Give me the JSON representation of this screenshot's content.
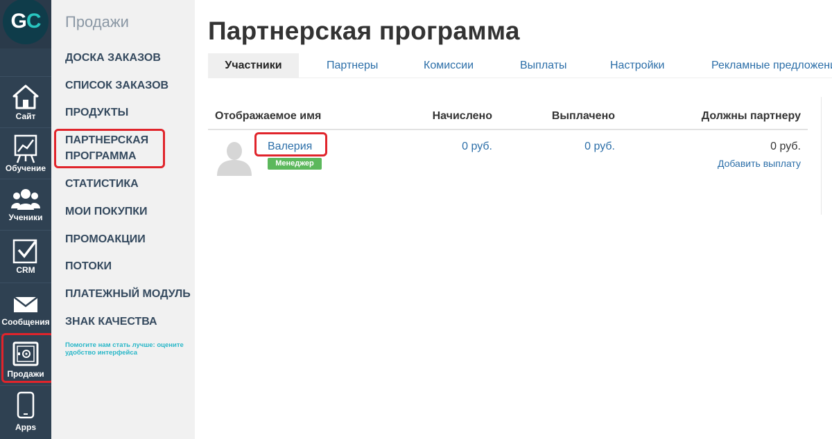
{
  "rail": {
    "logo": {
      "g": "G",
      "c": "C"
    },
    "items": [
      {
        "label": "Сайт",
        "icon": "home-icon"
      },
      {
        "label": "Обучение",
        "icon": "training-chart-icon"
      },
      {
        "label": "Ученики",
        "icon": "users-icon"
      },
      {
        "label": "CRM",
        "icon": "checkbox-icon"
      },
      {
        "label": "Сообщения",
        "icon": "envelope-icon"
      },
      {
        "label": "Продажи",
        "icon": "safe-icon"
      },
      {
        "label": "Apps",
        "icon": "smartphone-icon"
      }
    ]
  },
  "sidebar": {
    "title": "Продажи",
    "items": [
      {
        "label": "ДОСКА ЗАКАЗОВ"
      },
      {
        "label": "СПИСОК ЗАКАЗОВ"
      },
      {
        "label": "ПРОДУКТЫ"
      },
      {
        "label": "ПАРТНЕРСКАЯ ПРОГРАММА"
      },
      {
        "label": "СТАТИСТИКА"
      },
      {
        "label": "МОИ ПОКУПКИ"
      },
      {
        "label": "ПРОМОАКЦИИ"
      },
      {
        "label": "ПОТОКИ"
      },
      {
        "label": "ПЛАТЕЖНЫЙ МОДУЛЬ"
      },
      {
        "label": "ЗНАК КАЧЕСТВА"
      }
    ],
    "feedback": "Помогите нам стать лучше: оцените удобство интерфейса"
  },
  "main": {
    "title": "Партнерская программа",
    "tabs": [
      {
        "label": "Участники",
        "active": true
      },
      {
        "label": "Партнеры"
      },
      {
        "label": "Комиссии"
      },
      {
        "label": "Выплаты"
      },
      {
        "label": "Настройки"
      },
      {
        "label": "Рекламные предложения"
      }
    ],
    "table": {
      "headers": [
        "Отображаемое имя",
        "Начислено",
        "Выплачено",
        "Должны партнеру"
      ],
      "rows": [
        {
          "name": "Валерия",
          "badge": "Менеджер",
          "accrued": "0 руб.",
          "paid": "0 руб.",
          "owed": "0 руб.",
          "action": "Добавить выплату"
        }
      ]
    }
  },
  "colors": {
    "rail_bg": "#2f4152",
    "sidebar_bg": "#f1f1f1",
    "link": "#2b6ea8",
    "highlight": "#e0242b",
    "badge": "#5cb85c",
    "logo_accent": "#29c6c0"
  }
}
